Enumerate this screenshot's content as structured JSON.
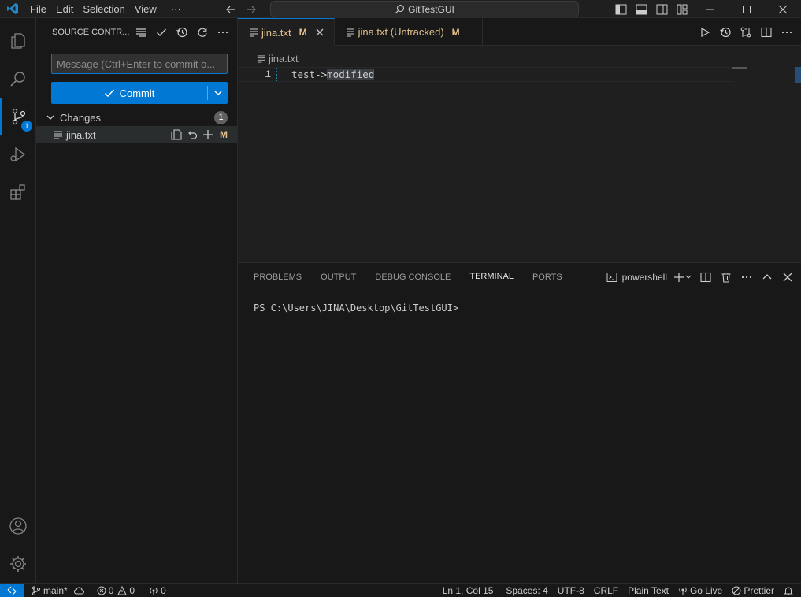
{
  "titlebar": {
    "menu": [
      "File",
      "Edit",
      "Selection",
      "View"
    ],
    "more": "···",
    "search_text": "GitTestGUI"
  },
  "activity": {
    "scm_badge": "1"
  },
  "sidebar": {
    "title": "SOURCE CONTR...",
    "message_placeholder": "Message (Ctrl+Enter to commit o...",
    "commit_label": "Commit",
    "changes_label": "Changes",
    "changes_count": "1",
    "file_name": "jina.txt",
    "file_status": "M"
  },
  "editor": {
    "tabs": [
      {
        "label": "jina.txt",
        "status": "M"
      },
      {
        "label": "jina.txt (Untracked)",
        "status": "M"
      }
    ],
    "breadcrumb": "jina.txt",
    "line_number": "1",
    "code_prefix": "test->",
    "code_highlight": "modified"
  },
  "panel": {
    "tabs": [
      "PROBLEMS",
      "OUTPUT",
      "DEBUG CONSOLE",
      "TERMINAL",
      "PORTS"
    ],
    "active_tab": "TERMINAL",
    "shell": "powershell",
    "terminal_prompt": "PS C:\\Users\\JINA\\Desktop\\GitTestGUI>"
  },
  "statusbar": {
    "branch": "main*",
    "errors": "0",
    "warnings": "0",
    "ports": "0",
    "position": "Ln 1, Col 15",
    "spaces": "Spaces: 4",
    "encoding": "UTF-8",
    "eol": "CRLF",
    "language": "Plain Text",
    "golive": "Go Live",
    "prettier": "Prettier"
  },
  "colors": {
    "accent": "#0078d4",
    "modified": "#e2c08d",
    "background": "#1f1f1f",
    "sidebar": "#181818"
  },
  "icons": [
    "vscode-logo-icon",
    "arrow-left-icon",
    "arrow-right-icon",
    "search-icon",
    "layout-icons",
    "files-icon",
    "search-icon",
    "source-control-icon",
    "run-debug-icon",
    "extensions-icon",
    "account-icon",
    "gear-icon"
  ]
}
